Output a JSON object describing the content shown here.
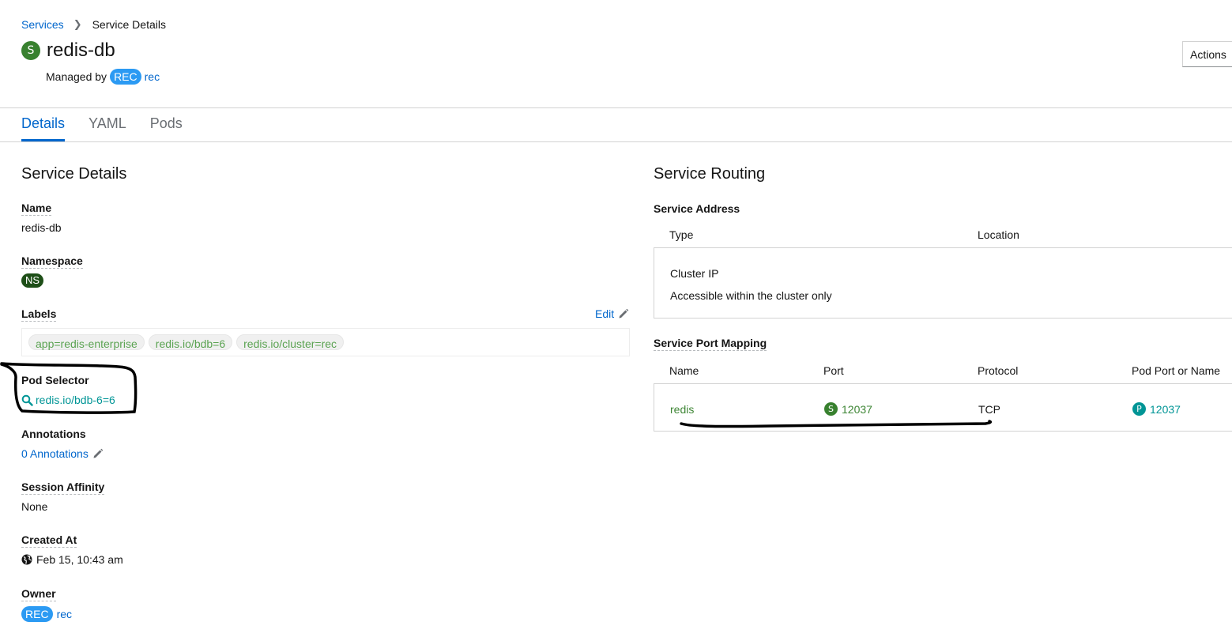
{
  "breadcrumb": {
    "parent": "Services",
    "current": "Service Details"
  },
  "header": {
    "badge": "S",
    "title": "redis-db",
    "managed_by_label": "Managed by",
    "managed_badge": "REC",
    "managed_name": "rec",
    "actions_label": "Actions"
  },
  "tabs": [
    {
      "label": "Details",
      "active": true
    },
    {
      "label": "YAML",
      "active": false
    },
    {
      "label": "Pods",
      "active": false
    }
  ],
  "details": {
    "section_title": "Service Details",
    "name_label": "Name",
    "name_value": "redis-db",
    "namespace_label": "Namespace",
    "namespace_badge": "NS",
    "labels_label": "Labels",
    "edit_label": "Edit",
    "labels": [
      "app=redis-enterprise",
      "redis.io/bdb=6",
      "redis.io/cluster=rec"
    ],
    "pod_selector_label": "Pod Selector",
    "pod_selector_value": "redis.io/bdb-6=6",
    "annotations_label": "Annotations",
    "annotations_value": "0 Annotations",
    "session_affinity_label": "Session Affinity",
    "session_affinity_value": "None",
    "created_at_label": "Created At",
    "created_at_value": "Feb 15, 10:43 am",
    "owner_label": "Owner",
    "owner_badge": "REC",
    "owner_name": "rec"
  },
  "routing": {
    "section_title": "Service Routing",
    "address_label": "Service Address",
    "address_columns": [
      "Type",
      "Location"
    ],
    "address_type": "Cluster IP",
    "address_desc": "Accessible within the cluster only",
    "port_mapping_label": "Service Port Mapping",
    "port_columns": [
      "Name",
      "Port",
      "Protocol",
      "Pod Port or Name"
    ],
    "port_row": {
      "name": "redis",
      "port_badge": "S",
      "port": "12037",
      "protocol": "TCP",
      "pod_port_badge": "P",
      "pod_port": "12037"
    }
  },
  "colors": {
    "link": "#0066cc",
    "service_badge": "#38812f",
    "namespace_badge": "#1e4f18",
    "rec_badge": "#2b9af3",
    "pod_badge": "#009596",
    "label_text": "#5ba352"
  }
}
